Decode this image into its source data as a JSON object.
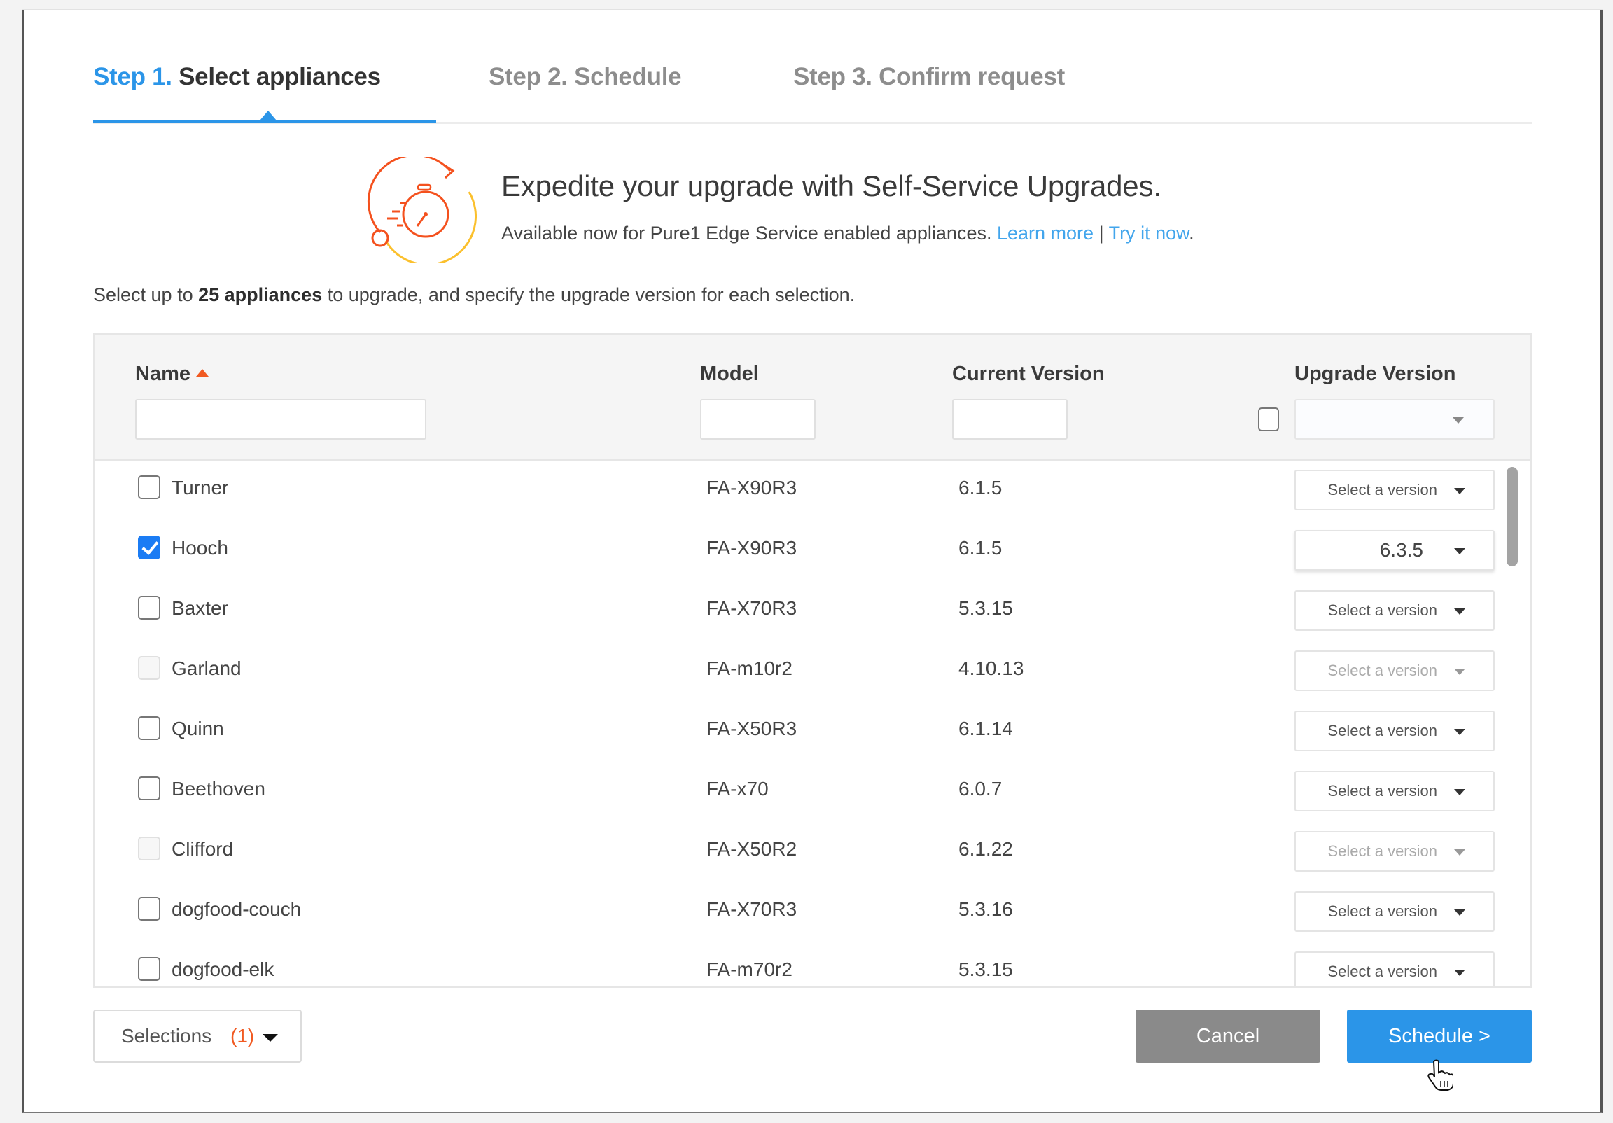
{
  "wizard": {
    "steps": [
      {
        "number": "Step 1.",
        "label": "Select appliances",
        "active": true
      },
      {
        "number": "Step 2.",
        "label": "Schedule",
        "active": false
      },
      {
        "number": "Step 3.",
        "label": "Confirm request",
        "active": false
      }
    ]
  },
  "banner": {
    "icon": "stopwatch-refresh-icon",
    "title": "Expedite your upgrade with Self-Service Upgrades.",
    "subtitle": "Available now for Pure1 Edge Service enabled appliances.",
    "learn_more": "Learn more",
    "separator": "|",
    "try_it_now": "Try it now",
    "trailing": "."
  },
  "instruction": {
    "prefix": "Select up to ",
    "bold": "25 appliances",
    "suffix": " to upgrade, and specify the upgrade version for each selection."
  },
  "table": {
    "columns": {
      "name": "Name",
      "model": "Model",
      "current_version": "Current Version",
      "upgrade_version": "Upgrade Version"
    },
    "sort": {
      "column": "Name",
      "direction": "ascending",
      "icon": "sort-ascending-icon"
    },
    "filters": {
      "name": "",
      "model": "",
      "current_version": ""
    },
    "bulk_upgrade_select": "",
    "rows": [
      {
        "name": "Turner",
        "model": "FA-X90R3",
        "current_version": "6.1.5",
        "upgrade_version": "Select a version",
        "checked": false,
        "disabled": false
      },
      {
        "name": "Hooch",
        "model": "FA-X90R3",
        "current_version": "6.1.5",
        "upgrade_version": "6.3.5",
        "checked": true,
        "disabled": false
      },
      {
        "name": "Baxter",
        "model": "FA-X70R3",
        "current_version": "5.3.15",
        "upgrade_version": "Select a version",
        "checked": false,
        "disabled": false
      },
      {
        "name": "Garland",
        "model": "FA-m10r2",
        "current_version": "4.10.13",
        "upgrade_version": "Select a version",
        "checked": false,
        "disabled": true
      },
      {
        "name": "Quinn",
        "model": "FA-X50R3",
        "current_version": "6.1.14",
        "upgrade_version": "Select a version",
        "checked": false,
        "disabled": false
      },
      {
        "name": "Beethoven",
        "model": "FA-x70",
        "current_version": "6.0.7",
        "upgrade_version": "Select a version",
        "checked": false,
        "disabled": false
      },
      {
        "name": "Clifford",
        "model": "FA-X50R2",
        "current_version": "6.1.22",
        "upgrade_version": "Select a version",
        "checked": false,
        "disabled": true
      },
      {
        "name": "dogfood-couch",
        "model": "FA-X70R3",
        "current_version": "5.3.16",
        "upgrade_version": "Select a version",
        "checked": false,
        "disabled": false
      },
      {
        "name": "dogfood-elk",
        "model": "FA-m70r2",
        "current_version": "5.3.15",
        "upgrade_version": "Select a version",
        "checked": false,
        "disabled": false
      }
    ]
  },
  "footer": {
    "selections_label": "Selections",
    "selections_count": "(1)",
    "cancel_label": "Cancel",
    "schedule_label": "Schedule >"
  },
  "colors": {
    "accent": "#2b95e8",
    "link": "#42a5ec",
    "sort_indicator": "#f15a22",
    "selection_count": "#f15a22",
    "checkbox_checked": "#1b7cf4",
    "cancel_button": "#8a8a8a",
    "icon_gradient_start": "#f4511e",
    "icon_gradient_end": "#fbc02d"
  }
}
